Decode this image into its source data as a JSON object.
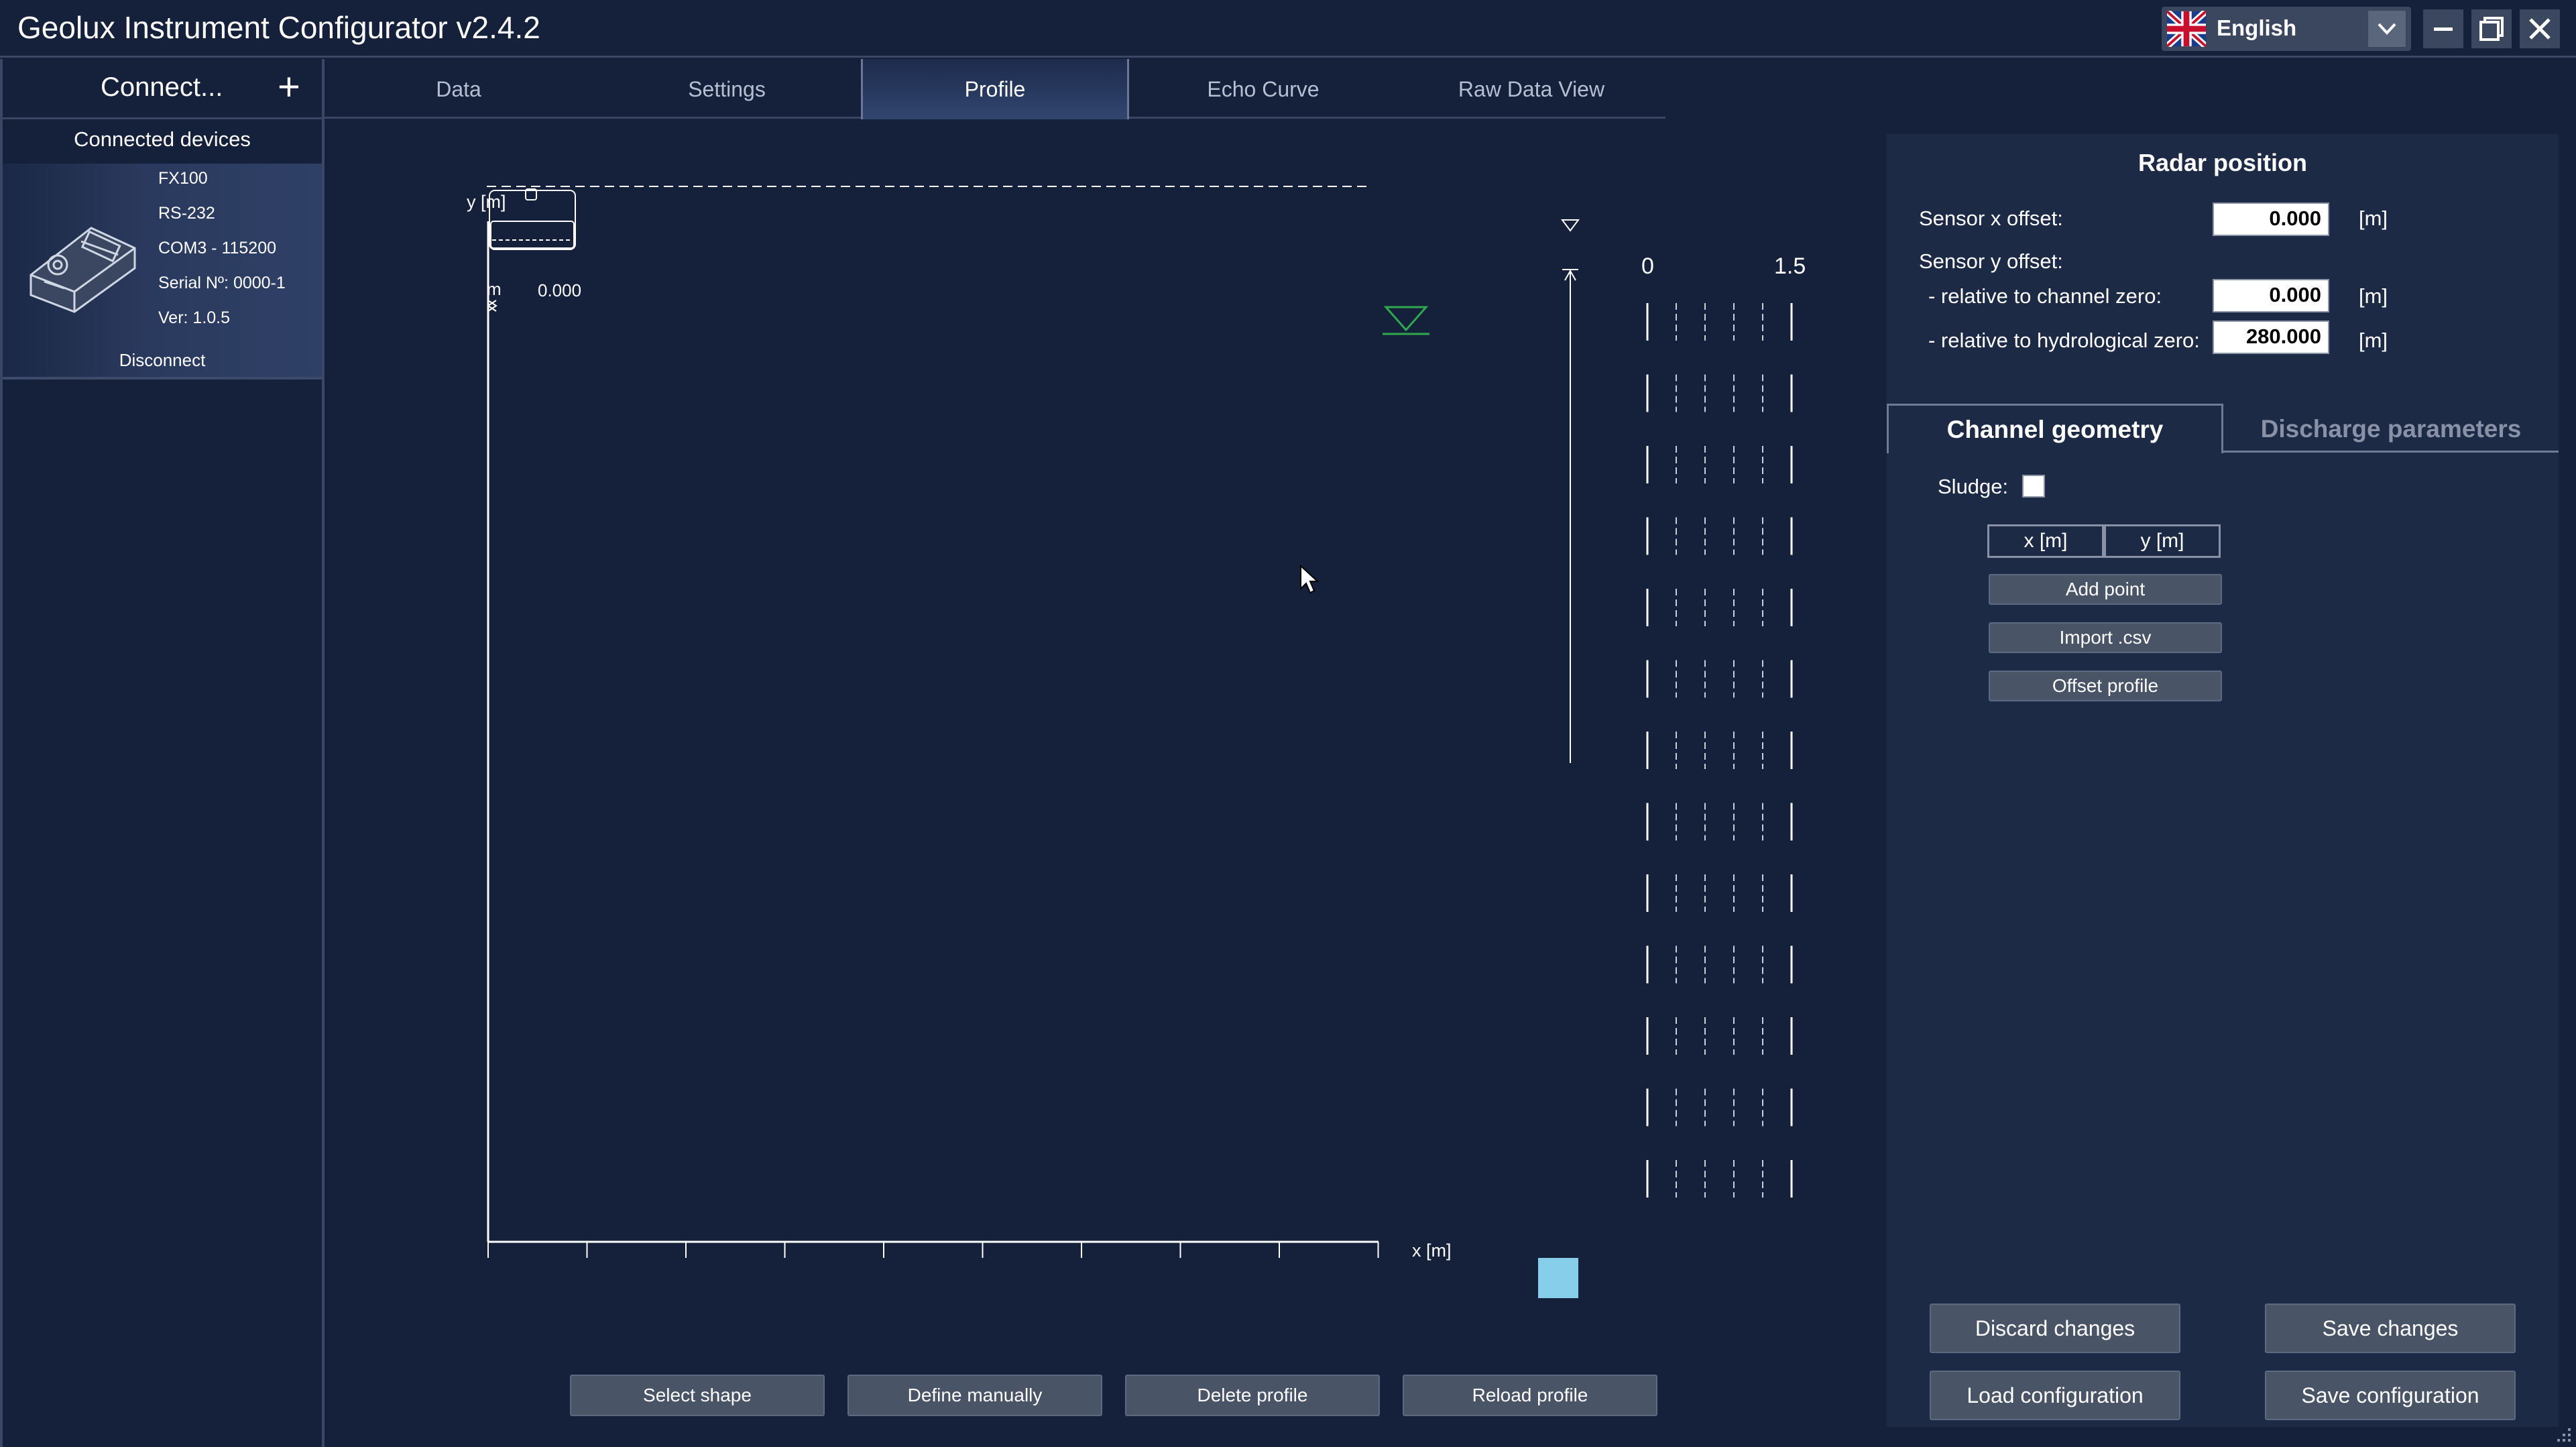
{
  "window": {
    "title": "Geolux Instrument Configurator v2.4.2",
    "language": "English",
    "flag_icon": "uk-flag-icon"
  },
  "sidebar": {
    "connect_label": "Connect...",
    "connected_title": "Connected devices",
    "device": {
      "model": "FX100",
      "interface": "RS-232",
      "port": "COM3 - 115200",
      "serial": "Serial Nº: 0000-1",
      "version": "Ver:  1.0.5"
    },
    "disconnect_label": "Disconnect"
  },
  "tabs": [
    {
      "label": "Data"
    },
    {
      "label": "Settings"
    },
    {
      "label": "Profile"
    },
    {
      "label": "Echo Curve"
    },
    {
      "label": "Raw Data View"
    }
  ],
  "active_tab": "Profile",
  "plot": {
    "y_axis_label": "y [m]",
    "x_axis_label": "x [m]",
    "sensor_value": "0.000",
    "sensor_unit": "m",
    "scale_min": "0",
    "scale_max": "1.5"
  },
  "profile_buttons": {
    "select_shape": "Select shape",
    "define_manually": "Define manually",
    "delete_profile": "Delete profile",
    "reload_profile": "Reload profile"
  },
  "radar": {
    "title": "Radar position",
    "sensor_x_label": "Sensor x offset:",
    "sensor_x_value": "0.000",
    "sensor_y_label": "Sensor y offset:",
    "rel_channel_label": "- relative to channel zero:",
    "rel_channel_value": "0.000",
    "rel_hydro_label": "- relative to hydrological zero:",
    "rel_hydro_value": "280.000",
    "unit": "[m]"
  },
  "panel_tabs": {
    "geometry": "Channel geometry",
    "discharge": "Discharge parameters"
  },
  "geometry": {
    "sludge_label": "Sludge:",
    "sludge_checked": false,
    "col_x": "x [m]",
    "col_y": "y [m]",
    "add_point": "Add point",
    "import_csv": "Import .csv",
    "offset_profile": "Offset profile"
  },
  "footer_buttons": {
    "discard": "Discard changes",
    "save_changes": "Save changes",
    "load_config": "Load configuration",
    "save_config": "Save configuration"
  },
  "colors": {
    "background": "#15203a",
    "panel": "#1d2a46",
    "button": "#4a5467",
    "water_marker": "#2fa84f",
    "swatch": "#87ceeb"
  }
}
